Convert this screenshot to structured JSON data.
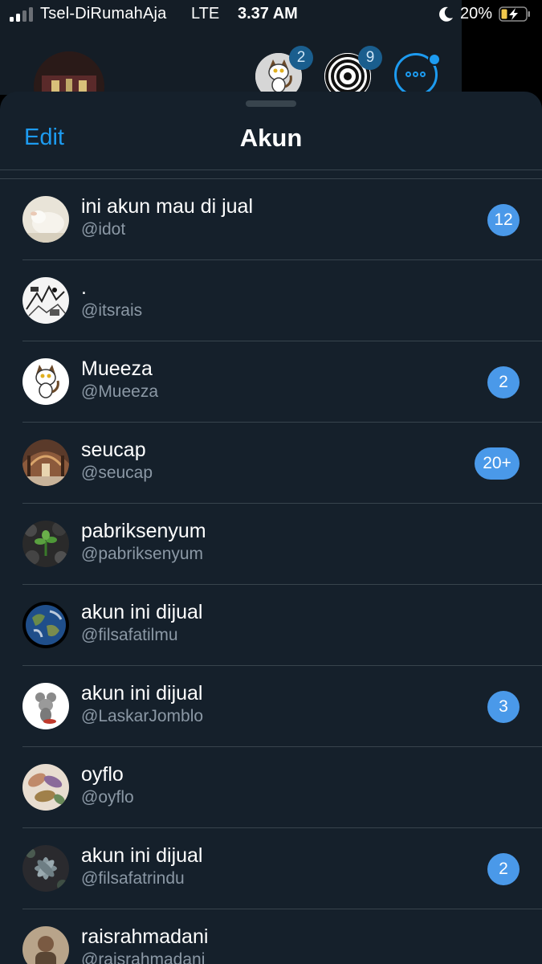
{
  "status_bar": {
    "carrier": "Tsel-DiRumahAja",
    "network": "LTE",
    "time": "3.37 AM",
    "battery_percent": "20%",
    "signal_bars_active": 2,
    "signal_bars_total": 4,
    "battery_level": 0.2
  },
  "background": {
    "top_accounts": [
      {
        "icon": "cat-avatar-icon",
        "badge": "2"
      },
      {
        "icon": "spiral-avatar-icon",
        "badge": "9"
      }
    ],
    "more_icon": "more-options-icon"
  },
  "sheet": {
    "edit_label": "Edit",
    "title": "Akun"
  },
  "accounts": [
    {
      "name": "ini akun mau di jual",
      "handle": "@idot",
      "badge": "12",
      "avatar": "lamb-photo-avatar"
    },
    {
      "name": ".",
      "handle": "@itsrais",
      "badge": "",
      "avatar": "sketch-avatar"
    },
    {
      "name": "Mueeza",
      "handle": "@Mueeza",
      "badge": "2",
      "avatar": "cat-avatar"
    },
    {
      "name": "seucap",
      "handle": "@seucap",
      "badge": "20+",
      "avatar": "mosque-interior-avatar"
    },
    {
      "name": "pabriksenyum",
      "handle": "@pabriksenyum",
      "badge": "",
      "avatar": "plant-stones-avatar"
    },
    {
      "name": "akun ini dijual",
      "handle": "@filsafatilmu",
      "badge": "",
      "avatar": "earth-avatar"
    },
    {
      "name": "akun ini dijual",
      "handle": "@LaskarJomblo",
      "badge": "3",
      "avatar": "mouse-toy-avatar"
    },
    {
      "name": "oyflo",
      "handle": "@oyflo",
      "badge": "",
      "avatar": "leaves-avatar"
    },
    {
      "name": "akun ini dijual",
      "handle": "@filsafatrindu",
      "badge": "2",
      "avatar": "succulent-avatar"
    },
    {
      "name": "raisrahmadani",
      "handle": "@raisrahmadani",
      "badge": "",
      "avatar": "person-photo-avatar"
    }
  ],
  "colors": {
    "accent": "#1d9bf0",
    "badge": "#4a99e9",
    "sheet_bg": "#15202b",
    "divider": "#38444d",
    "secondary_text": "#8b98a5"
  }
}
